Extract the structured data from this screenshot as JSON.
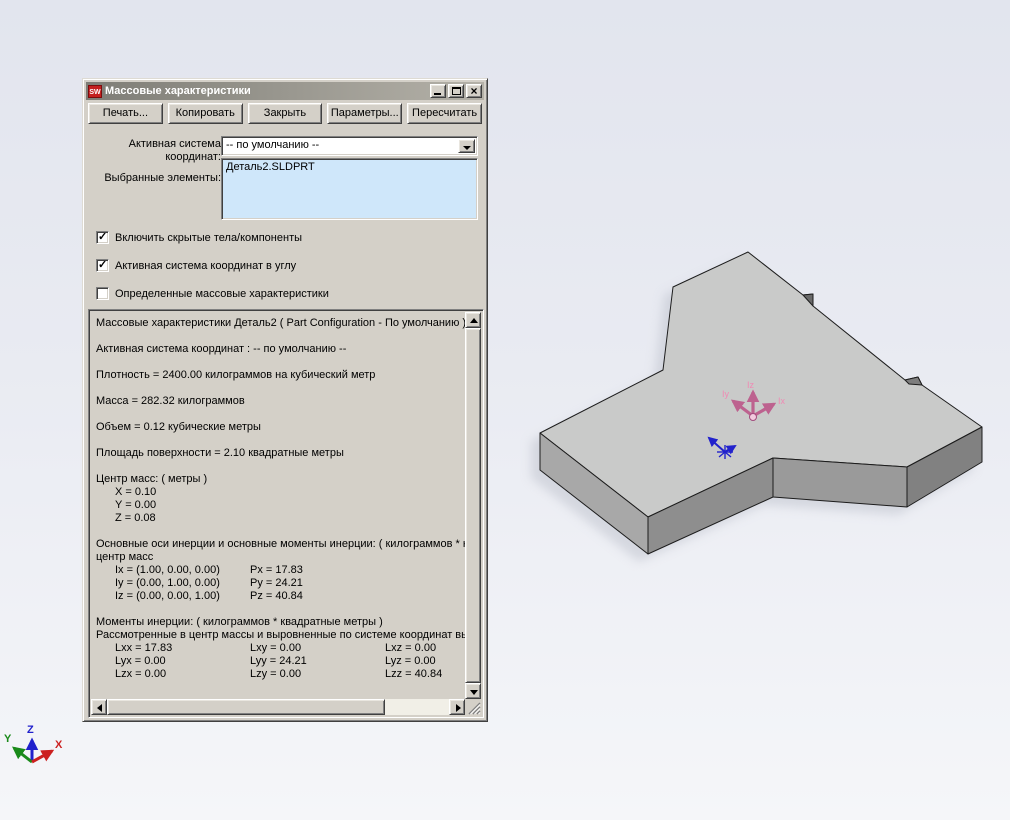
{
  "window": {
    "title": "Массовые характеристики",
    "icon_text": "SW",
    "close_glyph": "×"
  },
  "toolbar": {
    "buttons": [
      "Печать...",
      "Копировать",
      "Закрыть",
      "Параметры...",
      "Пересчитать"
    ]
  },
  "form": {
    "coord_system_label": "Активная система координат:",
    "coord_system_value": "-- по умолчанию --",
    "selected_items_label": "Выбранные элементы:",
    "selected_items": [
      "Деталь2.SLDPRT"
    ],
    "checkboxes": [
      {
        "label": "Включить скрытые тела/компоненты",
        "checked": true
      },
      {
        "label": "Активная система координат в углу",
        "checked": true
      },
      {
        "label": "Определенные массовые характеристики",
        "checked": false
      }
    ]
  },
  "results": {
    "lines": [
      {
        "t": [
          "Массовые характеристики Деталь2 ( Part Configuration - По умолчанию )"
        ]
      },
      {
        "t": [
          ""
        ]
      },
      {
        "t": [
          "Активная система координат : -- по умолчанию --"
        ]
      },
      {
        "t": [
          ""
        ]
      },
      {
        "t": [
          "Плотность = 2400.00 килограммов на кубический метр"
        ]
      },
      {
        "t": [
          ""
        ]
      },
      {
        "t": [
          "Масса = 282.32 килограммов"
        ]
      },
      {
        "t": [
          ""
        ]
      },
      {
        "t": [
          "Объем = 0.12 кубические метры"
        ]
      },
      {
        "t": [
          ""
        ]
      },
      {
        "t": [
          "Площадь поверхности = 2.10 квадратные метры"
        ]
      },
      {
        "t": [
          ""
        ]
      },
      {
        "t": [
          "Центр масс: ( метры )"
        ]
      },
      {
        "t": [
          "X = 0.10"
        ],
        "ind": 1
      },
      {
        "t": [
          "Y = 0.00"
        ],
        "ind": 1
      },
      {
        "t": [
          "Z = 0.08"
        ],
        "ind": 1
      },
      {
        "t": [
          ""
        ]
      },
      {
        "t": [
          "Основные оси инерции и основные моменты инерции: ( килограммов * кв"
        ]
      },
      {
        "t": [
          "центр масс"
        ]
      },
      {
        "t": [
          "Ix = (1.00, 0.00, 0.00)",
          "Px = 17.83"
        ],
        "ind": 1
      },
      {
        "t": [
          "Iy = (0.00, 1.00, 0.00)",
          "Py = 24.21"
        ],
        "ind": 1
      },
      {
        "t": [
          "Iz = (0.00, 0.00, 1.00)",
          "Pz = 40.84"
        ],
        "ind": 1
      },
      {
        "t": [
          ""
        ]
      },
      {
        "t": [
          "Моменты инерции: ( килограммов * квадратные метры )"
        ]
      },
      {
        "t": [
          "Рассмотренные в центр массы и выровненные по системе координат выв"
        ]
      },
      {
        "t": [
          "Lxx = 17.83",
          "Lxy = 0.00",
          "Lxz = 0.00"
        ],
        "ind": 1
      },
      {
        "t": [
          "Lyx = 0.00",
          "Lyy = 24.21",
          "Lyz = 0.00"
        ],
        "ind": 1
      },
      {
        "t": [
          "Lzx = 0.00",
          "Lzy = 0.00",
          "Lzz = 40.84"
        ],
        "ind": 1
      }
    ]
  },
  "viewport": {
    "part_file": "Деталь2.SLDPRT",
    "principal_axes_labels": {
      "ix": "Ix",
      "iy": "Iy",
      "iz": "Iz"
    },
    "triad_labels": {
      "x": "X",
      "y": "Y",
      "z": "Z"
    }
  },
  "colors": {
    "dialog_bg": "#d4d0c8",
    "titlebar_start": "#7e7d76",
    "titlebar_end": "#b4b1a8",
    "title_text": "#ffffff",
    "selection_bg": "#cfe7fa",
    "scroll_track": "#f1efe7",
    "viewport_top": "#e2e5ee",
    "viewport_bottom": "#f5f6f9",
    "part_top": "#c9cac9",
    "part_left": "#a8a8a8",
    "part_front_mid": "#8e8e8e",
    "part_front_right": "#9a9a9a",
    "part_right": "#818181",
    "sw_icon_red": "#c41f1f",
    "axis_x_red": "#cc2020",
    "axis_y_green": "#1a8a1a",
    "axis_z_blue": "#2020cc",
    "principal_axes_pink": "#bd628f",
    "principal_label_pink": "#f08ab4",
    "com_blue": "#2222cc"
  }
}
